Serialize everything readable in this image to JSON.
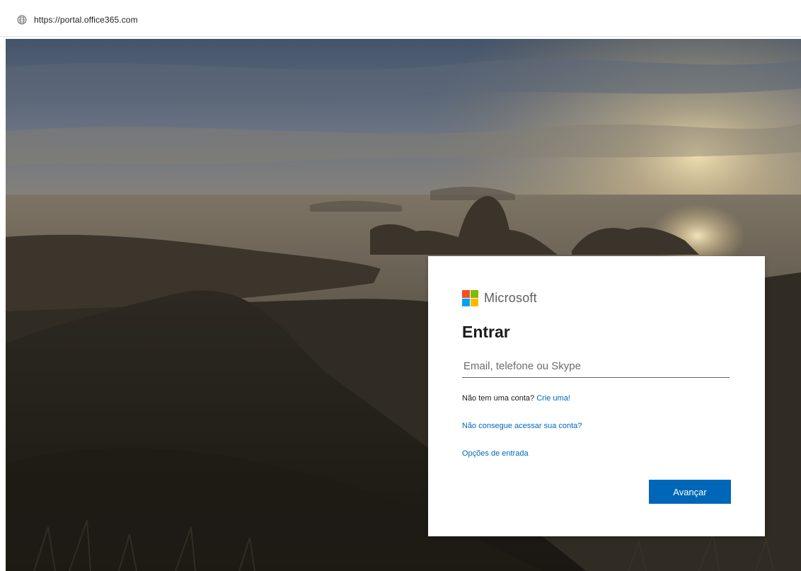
{
  "browser": {
    "url": "https://portal.office365.com",
    "url_icon": "globe-icon"
  },
  "signin": {
    "brand": "Microsoft",
    "title": "Entrar",
    "email_placeholder": "Email, telefone ou Skype",
    "no_account_text": "Não tem uma conta?",
    "create_link": "Crie uma!",
    "cant_access_link": "Não consegue acessar sua conta?",
    "options_link": "Opções de entrada",
    "next_button": "Avançar"
  },
  "colors": {
    "accent": "#0067b8",
    "logo_red": "#f25022",
    "logo_green": "#7fba00",
    "logo_blue": "#00a4ef",
    "logo_yellow": "#ffb900"
  }
}
